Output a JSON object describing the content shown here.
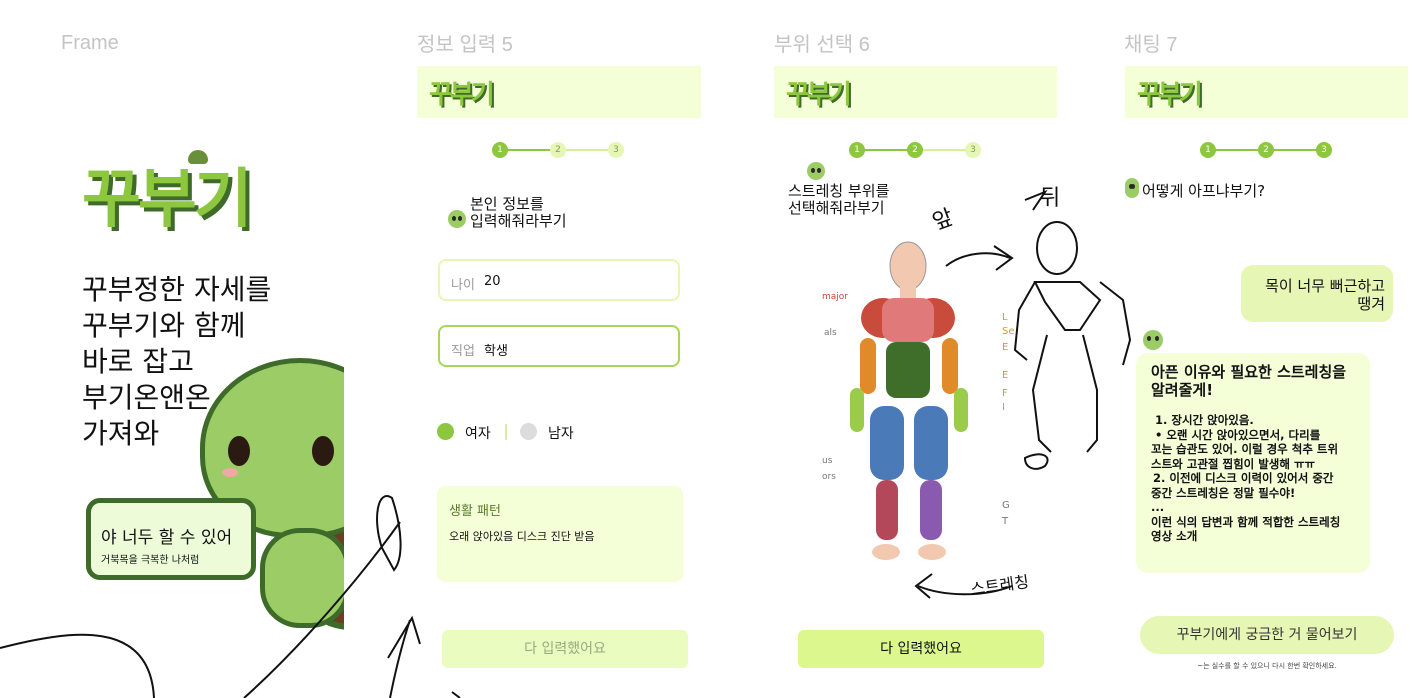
{
  "frames": {
    "frame1": "Frame",
    "frame2": "정보 입력 5",
    "frame3": "부위 선택 6",
    "frame4": "채팅 7"
  },
  "brand": {
    "logo": "꾸부기"
  },
  "splash": {
    "slogan": [
      "꾸부정한 자세를",
      "꾸부기와 함께",
      "바로 잡고",
      "부기온앤온",
      "가져와"
    ],
    "speech_main": "야 너두 할 수 있어",
    "speech_sub": "거북목을 극복한 나처럼"
  },
  "info": {
    "steps": [
      "1",
      "2",
      "3"
    ],
    "prompt": [
      "본인 정보를",
      "입력해줘라부기"
    ],
    "age_label": "나이",
    "age_value": "20",
    "job_label": "직업",
    "job_value": "학생",
    "gender_female": "여자",
    "gender_male": "남자",
    "pattern_title": "생활 패턴",
    "pattern_value": "오래 앉아있음 디스크 진단 받음",
    "submit": "다 입력했어요"
  },
  "body": {
    "steps": [
      "1",
      "2",
      "3"
    ],
    "prompt": [
      "스트레칭 부위를",
      "선택해줘라부기"
    ],
    "submit": "다 입력했어요",
    "chart_labels": [
      "major",
      "als",
      "us",
      "ors"
    ],
    "chart_labels_right": [
      "L",
      "Se",
      "E",
      "E",
      "F",
      "I",
      "G",
      "T"
    ],
    "sketch_front": "앞",
    "sketch_back": "뒤",
    "sketch_stretch": "스트레칭"
  },
  "chat": {
    "steps": [
      "1",
      "2",
      "3"
    ],
    "bot_question": "어떻게 아프냐부기?",
    "user_msg": [
      "목이 너무 뻐근하고",
      "땡겨"
    ],
    "bot_title": [
      "아픈 이유와 필요한 스트레칭을",
      "알려줄게!"
    ],
    "bot_body": [
      "1. 장시간 앉아있음.",
      "• 오랜 시간 앉아있으면서, 다리를",
      "꼬는 습관도 있어. 이럴 경우 척추 트위",
      "스트와 고관절 찝힘이 발생해 ㅠㅠ",
      "2. 이전에 디스크 이력이 있어서 중간",
      "중간 스트레칭은 정말 필수야!",
      "...",
      "이런 식의 답변과 함께 적합한 스트레칭",
      "영상 소개"
    ],
    "ask_button": "꾸부기에게 궁금한 거 물어보기",
    "disclaimer": "~는 실수를 할 수 있으니 다시 한번 확인하세요."
  },
  "colors": {
    "accent": "#8dc63f",
    "light": "#f4ffd8",
    "button": "#ddf78f"
  }
}
